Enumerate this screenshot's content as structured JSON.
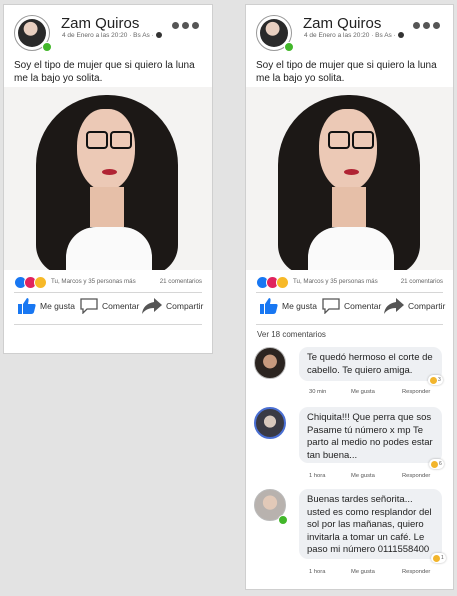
{
  "post": {
    "author": "Zam Quiros",
    "meta_text": "4 de Enero a las 20:20 · Bs As ·",
    "caption": "Soy el tipo de mujer que si quiero la luna me la bajo yo solita.",
    "reactions_text": "Tu, Marcos y 35 personas más",
    "comment_count": "21 comentarios",
    "actions": {
      "like": "Me gusta",
      "comment": "Comentar",
      "share": "Compartir"
    },
    "view_comments": "Ver 18 comentarios"
  },
  "comments": [
    {
      "text": "Te quedó hermoso el corte de cabello. Te quiero amiga.",
      "time": "30 min",
      "like": "Me gusta",
      "reply": "Responder",
      "reaction_count": "3"
    },
    {
      "text": "Chiquita!!! Que perra que sos Pasame tú número x mp Te parto al medio no podes estar tan buena...",
      "time": "1 hora",
      "like": "Me gusta",
      "reply": "Responder",
      "reaction_count": "6"
    },
    {
      "text": "Buenas tardes señorita... usted es como resplandor del sol por las mañanas, quiero invitarla a tomar un café. Le paso mi número 0111558400",
      "time": "1 hora",
      "like": "Me gusta",
      "reply": "Responder",
      "reaction_count": "1"
    }
  ],
  "colors": {
    "page_background": "#e3e3e3",
    "brand_blue": "#1877f2",
    "online_green": "#42b72a",
    "bubble_gray": "#eef0f3"
  },
  "icons": [
    "more-options-icon",
    "globe-icon",
    "like-icon",
    "comment-icon",
    "share-icon"
  ]
}
